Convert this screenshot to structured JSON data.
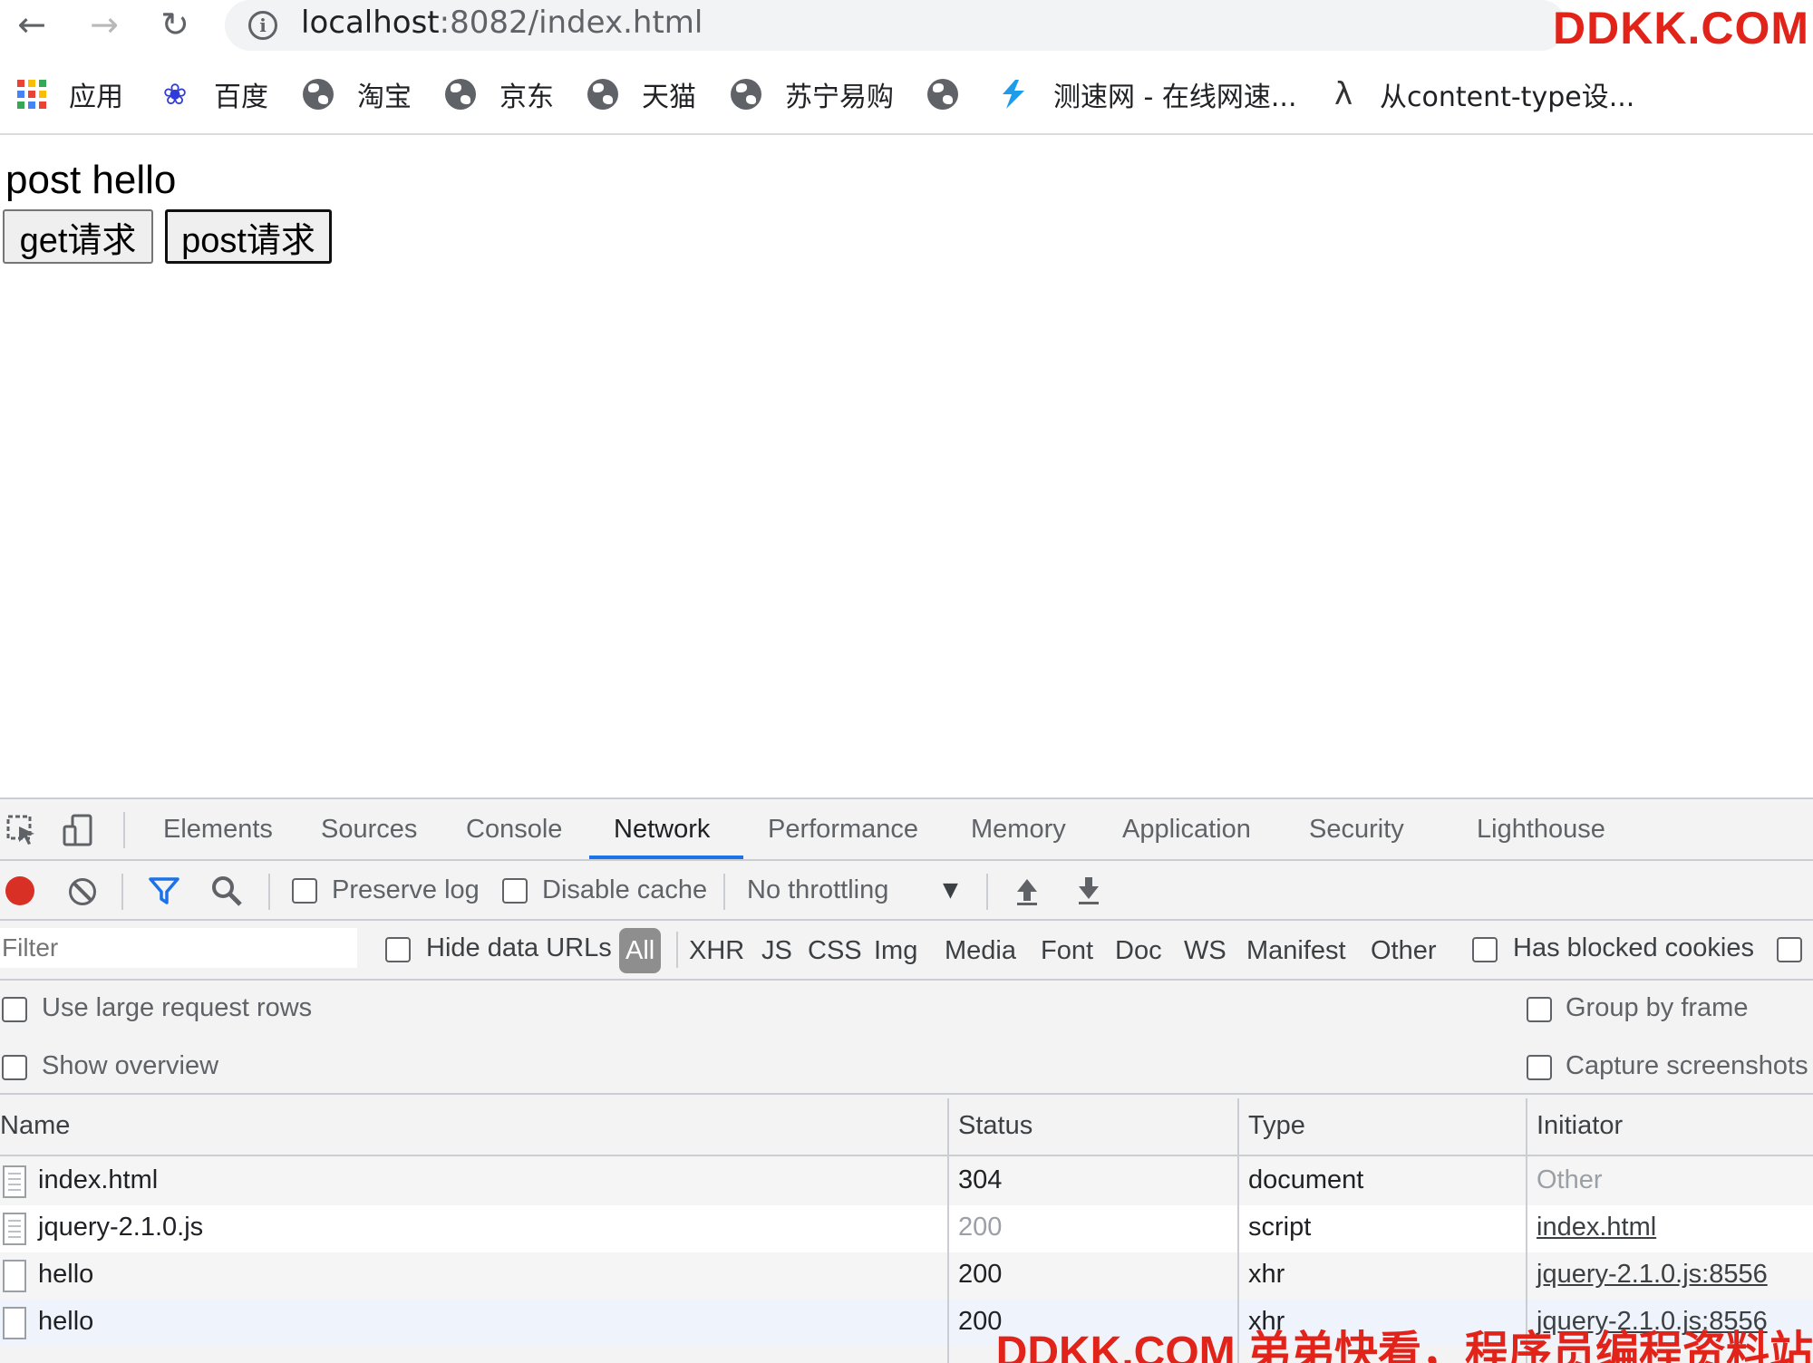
{
  "browser": {
    "url_host": "localhost",
    "url_rest": ":8082/index.html",
    "watermark_top": "DDKK.COM",
    "bookmarks": [
      {
        "label": "应用",
        "icon": "apps-icon"
      },
      {
        "label": "百度",
        "icon": "baidu-paw-icon"
      },
      {
        "label": "淘宝",
        "icon": "globe-icon"
      },
      {
        "label": "京东",
        "icon": "globe-icon"
      },
      {
        "label": "天猫",
        "icon": "globe-icon"
      },
      {
        "label": "苏宁易购",
        "icon": "globe-icon"
      },
      {
        "label": "",
        "icon": "globe-icon"
      },
      {
        "label": "测速网 - 在线网速...",
        "icon": "speedtest-icon"
      },
      {
        "label": "从content-type设...",
        "icon": "lambda-icon"
      }
    ]
  },
  "page": {
    "heading": "post hello",
    "get_button": "get请求",
    "post_button": "post请求"
  },
  "devtools": {
    "tabs": [
      "Elements",
      "Sources",
      "Console",
      "Network",
      "Performance",
      "Memory",
      "Application",
      "Security",
      "Lighthouse"
    ],
    "active_tab": "Network",
    "toolbar": {
      "preserve_log": "Preserve log",
      "disable_cache": "Disable cache",
      "throttling": "No throttling"
    },
    "filter": {
      "placeholder": "Filter",
      "hide_data_urls": "Hide data URLs",
      "types": [
        "All",
        "XHR",
        "JS",
        "CSS",
        "Img",
        "Media",
        "Font",
        "Doc",
        "WS",
        "Manifest",
        "Other"
      ],
      "has_blocked_cookies": "Has blocked cookies"
    },
    "options": {
      "large_rows": "Use large request rows",
      "show_overview": "Show overview",
      "group_by_frame": "Group by frame",
      "capture_screenshots": "Capture screenshots"
    },
    "table": {
      "headers": [
        "Name",
        "Status",
        "Type",
        "Initiator"
      ],
      "rows": [
        {
          "name": "index.html",
          "status": "304",
          "type": "document",
          "initiator": "Other"
        },
        {
          "name": "jquery-2.1.0.js",
          "status": "200",
          "type": "script",
          "initiator": "index.html"
        },
        {
          "name": "hello",
          "status": "200",
          "type": "xhr",
          "initiator": "jquery-2.1.0.js:8556"
        },
        {
          "name": "hello",
          "status": "200",
          "type": "xhr",
          "initiator": "jquery-2.1.0.js:8556"
        }
      ]
    }
  },
  "watermark_bottom": "DDKK.COM 弟弟快看，程序员编程资料站",
  "colors": {
    "record": "#d93025",
    "accent": "#1a73e8",
    "watermark": "#e2231a"
  }
}
